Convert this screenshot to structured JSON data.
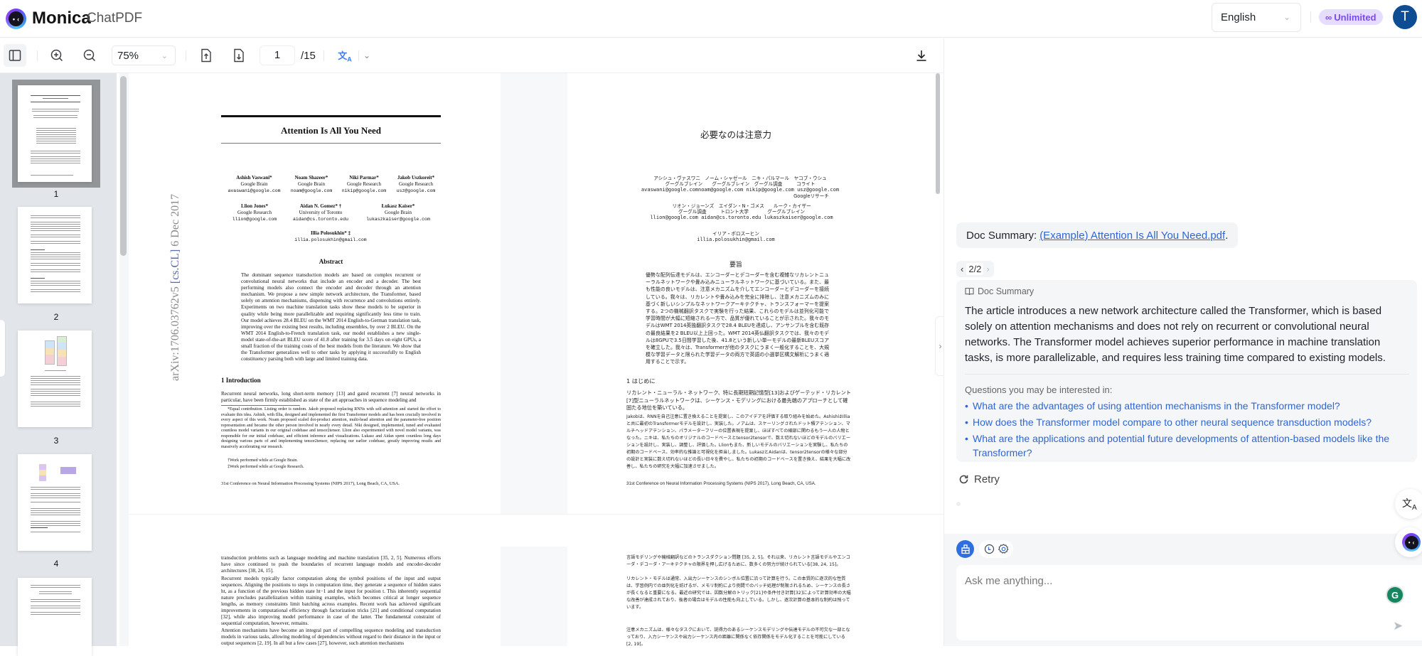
{
  "app": {
    "brand": "Monica",
    "product": "ChatPDF",
    "language": "English",
    "plan_badge": "Unlimited",
    "avatar_initial": "T"
  },
  "toolbar": {
    "zoom_level": "75%",
    "current_page": "1",
    "total_pages": "/15"
  },
  "thumbnails": [
    {
      "label": "1",
      "selected": true
    },
    {
      "label": "2",
      "selected": false
    },
    {
      "label": "3",
      "selected": false
    },
    {
      "label": "4",
      "selected": false
    }
  ],
  "pdf_original": {
    "arxiv_prefix": "arXiv:1706.03762v5 ",
    "arxiv_cat": "[cs.CL]",
    "arxiv_date": " 6 Dec 2017",
    "title": "Attention Is All You Need",
    "authors": [
      {
        "name": "Ashish Vaswani*",
        "org": "Google Brain",
        "email": "avaswani@google.com"
      },
      {
        "name": "Noam Shazeer*",
        "org": "Google Brain",
        "email": "noam@google.com"
      },
      {
        "name": "Niki Parmar*",
        "org": "Google Research",
        "email": "nikip@google.com"
      },
      {
        "name": "Jakob Uszkoreit*",
        "org": "Google Research",
        "email": "usz@google.com"
      },
      {
        "name": "Llion Jones*",
        "org": "Google Research",
        "email": "llion@google.com"
      },
      {
        "name": "Aidan N. Gomez* †",
        "org": "University of Toronto",
        "email": "aidan@cs.toronto.edu"
      },
      {
        "name": "Łukasz Kaiser*",
        "org": "Google Brain",
        "email": "lukaszkaiser@google.com"
      },
      {
        "name": "Illia Polosukhin* ‡",
        "org": "",
        "email": "illia.polosukhin@gmail.com"
      }
    ],
    "abstract_heading": "Abstract",
    "abstract": "The dominant sequence transduction models are based on complex recurrent or convolutional neural networks that include an encoder and a decoder. The best performing models also connect the encoder and decoder through an attention mechanism. We propose a new simple network architecture, the Transformer, based solely on attention mechanisms, dispensing with recurrence and convolutions entirely. Experiments on two machine translation tasks show these models to be superior in quality while being more parallelizable and requiring significantly less time to train. Our model achieves 28.4 BLEU on the WMT 2014 English-to-German translation task, improving over the existing best results, including ensembles, by over 2 BLEU. On the WMT 2014 English-to-French translation task, our model establishes a new single-model state-of-the-art BLEU score of 41.8 after training for 3.5 days on eight GPUs, a small fraction of the training costs of the best models from the literature. We show that the Transformer generalizes well to other tasks by applying it successfully to English constituency parsing both with large and limited training data.",
    "intro_heading": "1   Introduction",
    "intro": "Recurrent neural networks, long short-term memory [13] and gated recurrent [7] neural networks in particular, have been firmly established as state of the art approaches in sequence modeling and",
    "footnote_main": "*Equal contribution. Listing order is random. Jakob proposed replacing RNNs with self-attention and started the effort to evaluate this idea. Ashish, with Illia, designed and implemented the first Transformer models and has been crucially involved in every aspect of this work. Noam proposed scaled dot-product attention, multi-head attention and the parameter-free position representation and became the other person involved in nearly every detail. Niki designed, implemented, tuned and evaluated countless model variants in our original codebase and tensor2tensor. Llion also experimented with novel model variants, was responsible for our initial codebase, and efficient inference and visualizations. Lukasz and Aidan spent countless long days designing various parts of and implementing tensor2tensor, replacing our earlier codebase, greatly improving results and massively accelerating our research.",
    "footnote_dagger": "†Work performed while at Google Brain.",
    "footnote_ddagger": "‡Work performed while at Google Research.",
    "conference": "31st Conference on Neural Information Processing Systems (NIPS 2017), Long Beach, CA, USA.",
    "page2_p1": "transduction problems such as language modeling and machine translation [35, 2, 5]. Numerous efforts have since continued to push the boundaries of recurrent language models and encoder-decoder architectures [38, 24, 15].",
    "page2_p2": "Recurrent models typically factor computation along the symbol positions of the input and output sequences. Aligning the positions to steps in computation time, they generate a sequence of hidden states ht, as a function of the previous hidden state ht−1 and the input for position t. This inherently sequential nature precludes parallelization within training examples, which becomes critical at longer sequence lengths, as memory constraints limit batching across examples. Recent work has achieved significant improvements in computational efficiency through factorization tricks [21] and conditional computation [32], while also improving model performance in case of the latter. The fundamental constraint of sequential computation, however, remains.",
    "page2_p3": "Attention mechanisms have become an integral part of compelling sequence modeling and transduction models in various tasks, allowing modeling of dependencies without regard to their distance in the input or output sequences [2, 19]. In all but a few cases [27], however, such attention mechanisms"
  },
  "pdf_translated": {
    "title": "必要なのは注意力",
    "authors_row1_names": "アシシュ・ヴァスワニ　ノーム・シャゼール　ニキ・パルマール　ヤコブ・ウシュ",
    "authors_row1_orgs": "グーグルブレイン　　グーグルブレイン　グーグル調査　　　コライト",
    "authors_row1_emails": "avaswani@google.comnoam@google.com nikip@google.com usz@google.com",
    "authors_row1_extra": "Googleリサーチ",
    "authors_row2_names": "リオン・ジョーンズ　エイダン・N・ゴメス　　ルーク・カイザー",
    "authors_row2_orgs": "グーグル調査　　　トロント大学　　　　グーグルブレイン",
    "authors_row2_emails": "llion@google.com  aidan@cs.toronto.edu  lukaszkaiser@google.com",
    "authors_row3_name": "イリア・ポロスーヒン",
    "authors_row3_email": "illia.polosukhin@gmail.com",
    "abstract_heading": "要旨",
    "abstract": "優勢な配列伝達モデルは、エンコーダーとデコーダーを含む複雑なリカレントニューラルネットワークや畳み込みニューラルネットワークに基づいている。また、最も性能の良いモデルは、注意メカニズムを介してエンコーダーとデコーダーを接続している。我々は、リカレントや畳み込みを完全に排除し、注意メカニズムのみに基づく新しいシンプルなネットワークアーキテクチャ、トランスフォーマーを提案する。2つの機械翻訳タスクで実験を行った結果、これらのモデルは並列化可能で学習時間が大幅に短縮される一方で、品質が優れていることが示された。我々のモデルはWMT 2014英独翻訳タスクで28.4 BLEUを達成し、アンサンブルを含む既存の最良結果を2 BLEU以上上回った。WMT 2014英仏翻訳タスクでは、我々のモデルは8GPUで3.5日間学習した後、41.8という新しい単一モデルの最新BLEUスコアを確立した。我々は、Transformerが他のタスクにうまく一般化することを、大規模な学習データと限られた学習データの両方で英語の小選挙区構文解析にうまく適用することで示す。",
    "intro_heading": "1 はじめに",
    "intro": "リカレント・ニューラル・ネットワーク、特に長期短期記憶型[13]およびゲーテッド・リカレント[7]型ニューラルネットワークは、シーケンス・モデリングにおける最先端のアプローチとして確固たる地位を築いている。",
    "footnote": "Jakobは、RNNを自己注意に置き換えることを提案し、このアイデアを評価する取り組みを始めた。AshishはIlliaと共に最初のTransformerモデルを設計し、実装した。ノアムは、スケーリングされたドット積アテンション、マルチヘッドアテンション、パラメーターフリーの位置表現を提案し、ほぼすべての細部に関わるもう一人の人物となった。ニキは、私たちのオリジナルのコードベースとtensor2tensorで、数え切れないほどのモデルのバリエーションを設計し、実装し、調整し、評価した。Llionもまた、新しいモデルのバリエーションを実験し、私たちの初期のコードベース、効率的な推論と可視化を担当しました。LukaszとAidanは、tensor2tensorの様々な部分の設計と実装に数え切れないほどの長い日々を費やし、私たちの初期のコードベースを置き換え、結果を大幅に改善し、私たちの研究を大幅に加速させました。",
    "conference": "31st Conference on Neural Information Processing Systems (NIPS 2017), Long Beach, CA, USA.",
    "page2_p1": "言語モデリングや機械翻訳などのトランスダクション問題 [35, 2, 5]。それ以来、リカレント言語モデルやエンコーダ・デコーダ・アーキテクチャの限界を押し広げるために、数多くの努力が続けられている[38, 24, 15]。",
    "page2_p2": "リカレント・モデルは通常、入出力シーケンスのシンボル位置に沿って計算を行う。この本質的に逐次的な性質は、学習例内での並列化を妨げるが、メモリ制約により例間でのバッチ処理が制限されるため、シーケンスの長さが長くなると重要になる。最近の研究では、因数分解のトリック[21]や条件付き計算[32]によって計算効率の大幅な改善が達成されており、後者の場合はモデルの性能も向上している。しかし、逐次計算の基本的な制約は残っています。",
    "page2_p3": "注意メカニズムは、様々なタスクにおいて、説得力のあるシーケンスモデリングや伝達モデルの不可欠な一部となっており、入力シーケンスや出力シーケンス内の距離に関係なく依存関係をモデル化することを可能にしている[2, 19]。"
  },
  "chat": {
    "doc_summary_prefix": "Doc Summary:",
    "doc_summary_link": "(Example) Attention Is All You Need.pdf",
    "doc_summary_suffix": ".",
    "pager_current": "2/2",
    "summary_label": "Doc Summary",
    "summary_text": "The article introduces a new network architecture called the Transformer, which is based solely on attention mechanisms and does not rely on recurrent or convolutional neural networks. The Transformer model achieves superior performance in machine translation tasks, is more parallelizable, and requires less training time compared to existing models.",
    "questions_label": "Questions you may be interested in:",
    "questions": [
      "What are the advantages of using attention mechanisms in the Transformer model?",
      "How does the Transformer model compare to other neural sequence transduction models?",
      "What are the applications and potential future developments of attention-based models like the Transformer?"
    ],
    "retry_label": "Retry",
    "input_placeholder": "Ask me anything...",
    "grammarly_letter": "G"
  },
  "colors": {
    "accent": "#2e6fe0",
    "link": "#2f66d6",
    "badge_bg": "#e6dcfd",
    "badge_text": "#7b4af2",
    "avatar": "#0e4d94"
  }
}
